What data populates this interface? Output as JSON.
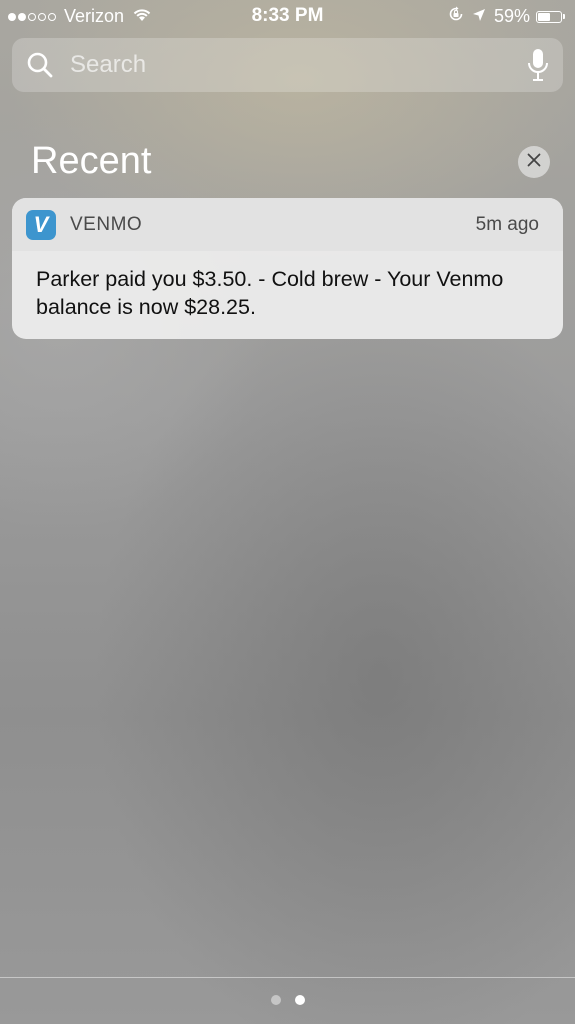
{
  "status_bar": {
    "signal_filled": 2,
    "signal_total": 5,
    "carrier": "Verizon",
    "time": "8:33 PM",
    "battery_percent": "59%",
    "battery_level": 0.59
  },
  "search": {
    "placeholder": "Search"
  },
  "recent": {
    "title": "Recent"
  },
  "notification": {
    "app_name": "VENMO",
    "app_icon_letter": "V",
    "time_ago": "5m ago",
    "message": "Parker paid you $3.50. - Cold brew - Your Venmo balance is now $28.25.",
    "accent_color": "#3d95ce"
  },
  "pagination": {
    "count": 2,
    "active_index": 1
  }
}
